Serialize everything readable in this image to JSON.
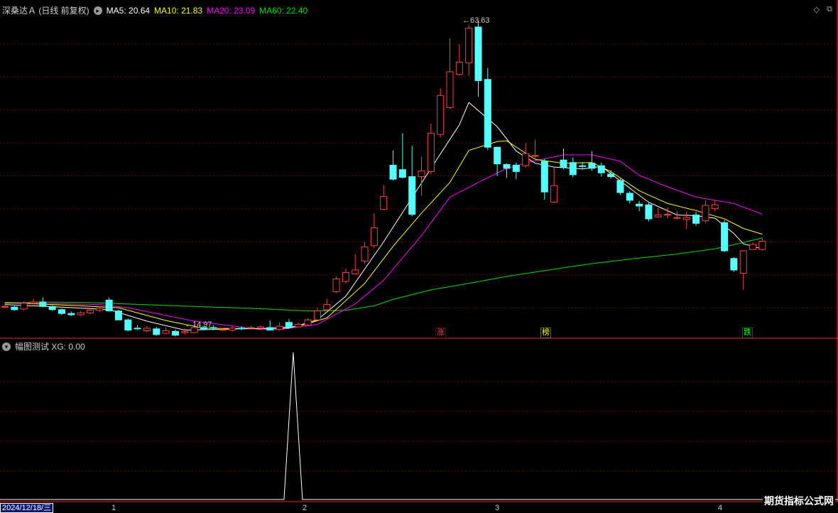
{
  "header": {
    "title": "深桑达Ａ (日线 前复权)",
    "ma": [
      {
        "label": "MA5: 20.64",
        "color": "#ffffff"
      },
      {
        "label": "MA10: 21.83",
        "color": "#ffff00"
      },
      {
        "label": "MA20: 23.09",
        "color": "#ff00ff"
      },
      {
        "label": "MA60: 22.40",
        "color": "#00e000"
      }
    ]
  },
  "sub_header": {
    "label": "幅图测试 XG: 0.00"
  },
  "annotations": {
    "high": "63.63",
    "low": "14.97"
  },
  "tags": [
    {
      "text": "涨",
      "color": "#ff4040"
    },
    {
      "text": "榜",
      "color": "#ffff00"
    },
    {
      "text": "跌",
      "color": "#00ff00"
    }
  ],
  "xaxis": {
    "date_box": "2024/12/18/三",
    "months": [
      "1",
      "2",
      "3",
      "4"
    ]
  },
  "watermark": "期货指标公式网",
  "top_controls": {
    "diamond": "◇",
    "restore": "⧉"
  },
  "colors": {
    "up": "#ff4040",
    "down": "#54ffff",
    "grid": "#7a0000",
    "divider": "#ff2020",
    "ma5": "#ffffff",
    "ma10": "#ffff00",
    "ma20": "#ff00ff",
    "ma60": "#00e000"
  },
  "chart_data": {
    "type": "candlestick",
    "candles": [
      [
        18.9,
        18.9,
        19.6,
        18.7
      ],
      [
        18.8,
        18.4,
        19.0,
        18.2
      ],
      [
        18.5,
        19.4,
        19.7,
        18.3
      ],
      [
        19.4,
        19.6,
        20.1,
        19.2
      ],
      [
        19.6,
        18.9,
        20.3,
        18.8
      ],
      [
        18.9,
        18.4,
        19.1,
        18.2
      ],
      [
        18.4,
        17.8,
        18.6,
        17.6
      ],
      [
        17.8,
        17.6,
        18.1,
        17.4
      ],
      [
        17.6,
        17.9,
        18.2,
        17.4
      ],
      [
        17.9,
        18.3,
        18.7,
        17.7
      ],
      [
        18.3,
        18.6,
        18.9,
        18.0
      ],
      [
        19.9,
        18.2,
        20.3,
        18.1
      ],
      [
        18.2,
        16.8,
        18.4,
        16.7
      ],
      [
        16.8,
        15.2,
        17.0,
        15.0
      ],
      [
        15.5,
        15.4,
        16.0,
        15.2
      ],
      [
        15.1,
        15.5,
        15.8,
        14.9
      ],
      [
        15.4,
        14.5,
        15.7,
        14.3
      ],
      [
        14.7,
        15.1,
        15.6,
        14.6
      ],
      [
        15.0,
        14.4,
        15.3,
        14.2
      ],
      [
        14.8,
        14.97,
        15.5,
        14.5
      ],
      [
        14.8,
        15.6,
        16.0,
        14.7
      ],
      [
        15.6,
        15.4,
        15.8,
        15.2
      ],
      [
        15.6,
        15.5,
        16.0,
        15.2
      ],
      [
        15.2,
        15.3,
        15.5,
        15.0
      ],
      [
        15.2,
        15.5,
        15.8,
        15.0
      ],
      [
        15.5,
        15.4,
        15.8,
        15.2
      ],
      [
        15.5,
        15.6,
        15.9,
        15.3
      ],
      [
        15.5,
        15.7,
        15.9,
        15.3
      ],
      [
        15.6,
        15.2,
        16.7,
        15.2
      ],
      [
        15.3,
        15.8,
        16.4,
        15.1
      ],
      [
        16.4,
        15.6,
        16.9,
        15.4
      ],
      [
        15.7,
        16.1,
        16.4,
        15.6
      ],
      [
        16.0,
        16.8,
        17.1,
        15.9
      ],
      [
        16.8,
        18.2,
        18.7,
        16.7
      ],
      [
        18.4,
        19.2,
        20.1,
        18.2
      ],
      [
        21.2,
        23.2,
        23.6,
        21.0
      ],
      [
        22.8,
        24.2,
        24.8,
        22.5
      ],
      [
        24.0,
        24.6,
        27.1,
        23.9
      ],
      [
        26.0,
        28.2,
        29.0,
        25.6
      ],
      [
        28.4,
        31.2,
        33.5,
        28.1
      ],
      [
        34.1,
        36.1,
        37.9,
        33.9
      ],
      [
        41.0,
        38.8,
        43.3,
        38.6
      ],
      [
        40.3,
        39.1,
        46.0,
        38.9
      ],
      [
        39.2,
        33.3,
        44.0,
        33.0
      ],
      [
        39.2,
        40.1,
        42.3,
        36.2
      ],
      [
        40.0,
        46.0,
        47.5,
        39.6
      ],
      [
        45.8,
        51.9,
        53.0,
        45.3
      ],
      [
        50.0,
        55.6,
        60.8,
        49.8
      ],
      [
        55.2,
        57.1,
        59.9,
        55.0
      ],
      [
        57.0,
        62.4,
        62.9,
        55.0
      ],
      [
        62.6,
        54.2,
        63.63,
        51.7
      ],
      [
        54.4,
        43.8,
        56.2,
        43.4
      ],
      [
        43.8,
        41.2,
        43.9,
        39.3
      ],
      [
        41.1,
        40.5,
        41.3,
        39.0
      ],
      [
        41.0,
        40.0,
        41.4,
        38.8
      ],
      [
        40.9,
        42.8,
        44.4,
        40.6
      ],
      [
        42.5,
        42.5,
        45.0,
        41.8
      ],
      [
        41.6,
        36.8,
        42.0,
        35.6
      ],
      [
        35.2,
        37.8,
        40.6,
        35.1
      ],
      [
        41.8,
        40.6,
        43.6,
        40.3
      ],
      [
        41.4,
        39.5,
        42.2,
        39.1
      ],
      [
        40.9,
        40.8,
        41.5,
        40.3
      ],
      [
        41.3,
        40.5,
        43.2,
        40.1
      ],
      [
        40.9,
        39.8,
        41.4,
        39.2
      ],
      [
        39.6,
        39.2,
        40.2,
        38.9
      ],
      [
        38.6,
        36.7,
        38.9,
        36.3
      ],
      [
        36.6,
        35.5,
        36.9,
        35.0
      ],
      [
        34.9,
        34.6,
        35.4,
        33.8
      ],
      [
        34.8,
        32.6,
        35.1,
        32.2
      ],
      [
        32.9,
        33.2,
        34.3,
        32.8
      ],
      [
        33.2,
        33.3,
        34.4,
        32.7
      ],
      [
        32.7,
        32.8,
        33.8,
        32.6
      ],
      [
        32.5,
        32.8,
        33.7,
        31.0
      ],
      [
        33.2,
        31.9,
        33.7,
        31.5
      ],
      [
        32.3,
        34.7,
        35.5,
        32.0
      ],
      [
        34.2,
        34.8,
        35.5,
        33.8
      ],
      [
        32.0,
        27.6,
        32.4,
        27.4
      ],
      [
        26.4,
        24.6,
        26.6,
        24.3
      ],
      [
        24.1,
        27.6,
        27.7,
        21.5
      ],
      [
        27.8,
        28.6,
        28.9,
        28.0
      ],
      [
        27.8,
        29.1,
        29.6,
        27.6
      ]
    ],
    "ma": {
      "ma5": [
        [
          0,
          19.2
        ],
        [
          6,
          18.8
        ],
        [
          11,
          18.4
        ],
        [
          15,
          16.6
        ],
        [
          19,
          15.2
        ],
        [
          25,
          15.4
        ],
        [
          30,
          15.5
        ],
        [
          33,
          16.8
        ],
        [
          36,
          20.5
        ],
        [
          40,
          29.0
        ],
        [
          44,
          38.2
        ],
        [
          48,
          47.3
        ],
        [
          49,
          50.8
        ],
        [
          52,
          47.0
        ],
        [
          54,
          43.2
        ],
        [
          56,
          41.3
        ],
        [
          58,
          40.7
        ],
        [
          61,
          40.4
        ],
        [
          63,
          40.8
        ],
        [
          66,
          37.4
        ],
        [
          68,
          35.2
        ],
        [
          71,
          33.2
        ],
        [
          73,
          33.1
        ],
        [
          75,
          32.7
        ],
        [
          77,
          30.3
        ],
        [
          78,
          28.7
        ],
        [
          80,
          27.9
        ]
      ],
      "ma10": [
        [
          0,
          19.5
        ],
        [
          8,
          19.0
        ],
        [
          12,
          18.7
        ],
        [
          17,
          16.7
        ],
        [
          21,
          15.5
        ],
        [
          27,
          15.4
        ],
        [
          31,
          15.8
        ],
        [
          34,
          17.1
        ],
        [
          38,
          22.5
        ],
        [
          41,
          28.3
        ],
        [
          44,
          33.5
        ],
        [
          47,
          38.3
        ],
        [
          49,
          43.3
        ],
        [
          52,
          44.7
        ],
        [
          53,
          44.8
        ],
        [
          56,
          41.9
        ],
        [
          59,
          41.3
        ],
        [
          62,
          41.4
        ],
        [
          64,
          40.0
        ],
        [
          67,
          37.0
        ],
        [
          70,
          35.0
        ],
        [
          73,
          33.9
        ],
        [
          76,
          32.6
        ],
        [
          78,
          31.1
        ],
        [
          80,
          30.2
        ]
      ],
      "ma20": [
        [
          0,
          19.5
        ],
        [
          10,
          19.2
        ],
        [
          13,
          18.7
        ],
        [
          20,
          16.6
        ],
        [
          27,
          15.3
        ],
        [
          29,
          15.3
        ],
        [
          33,
          16.1
        ],
        [
          37,
          19.3
        ],
        [
          40,
          23.0
        ],
        [
          44,
          30.0
        ],
        [
          47,
          36.0
        ],
        [
          50,
          38.3
        ],
        [
          53,
          40.5
        ],
        [
          56,
          41.7
        ],
        [
          59,
          42.6
        ],
        [
          62,
          42.6
        ],
        [
          65,
          41.6
        ],
        [
          67,
          39.4
        ],
        [
          70,
          37.6
        ],
        [
          73,
          36.0
        ],
        [
          77,
          35.0
        ],
        [
          80,
          33.3
        ]
      ],
      "ma60": [
        [
          0,
          19.4
        ],
        [
          4,
          19.6
        ],
        [
          9,
          19.5
        ],
        [
          18,
          19.0
        ],
        [
          26,
          18.6
        ],
        [
          32,
          18.2
        ],
        [
          36,
          18.3
        ],
        [
          39,
          19.0
        ],
        [
          41,
          20.0
        ],
        [
          45,
          21.5
        ],
        [
          49,
          22.5
        ],
        [
          53,
          23.6
        ],
        [
          57,
          24.5
        ],
        [
          62,
          25.6
        ],
        [
          66,
          26.3
        ],
        [
          71,
          27.1
        ],
        [
          75,
          27.9
        ],
        [
          78,
          28.9
        ],
        [
          80,
          29.6
        ]
      ]
    },
    "xg": {
      "spike_index": 30,
      "value": 1
    },
    "xg_title": "幅图测试",
    "xg_value": "0.00"
  }
}
